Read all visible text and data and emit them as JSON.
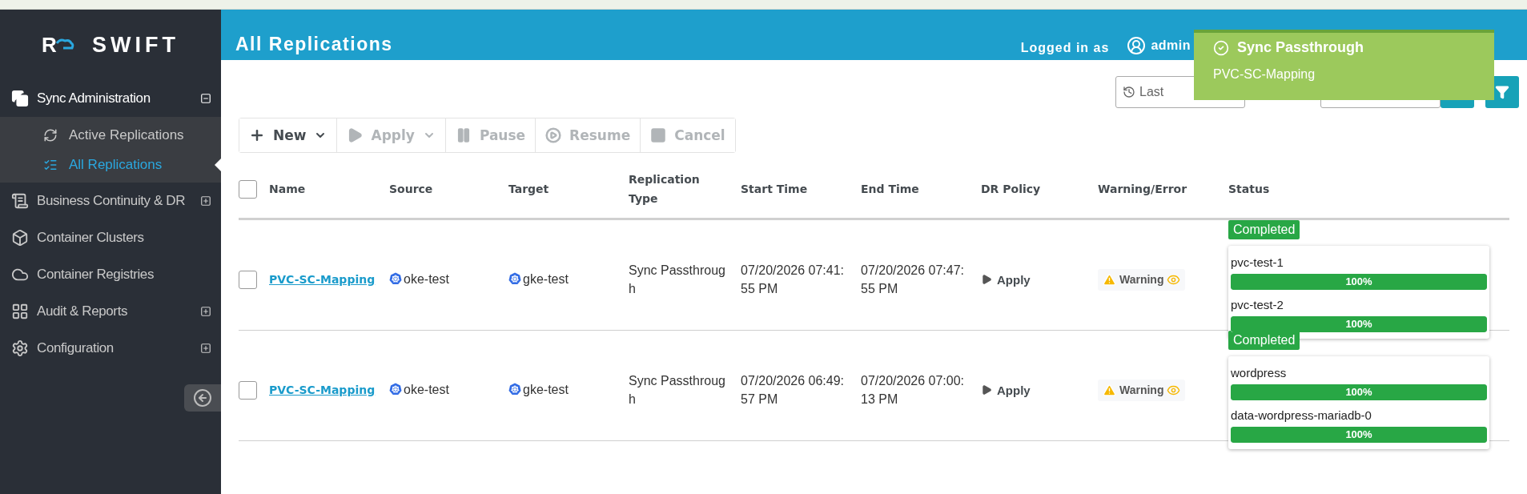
{
  "sidebar": {
    "logo": {
      "mark": "R",
      "text": "SWIFT"
    },
    "items": [
      {
        "label": "Sync Administration",
        "expanded": true,
        "children": [
          {
            "label": "Active Replications",
            "selected": false
          },
          {
            "label": "All Replications",
            "selected": true
          }
        ]
      },
      {
        "label": "Business Continuity & DR",
        "expanded": false
      },
      {
        "label": "Container Clusters"
      },
      {
        "label": "Container Registries"
      },
      {
        "label": "Audit & Reports",
        "expanded": false
      },
      {
        "label": "Configuration",
        "expanded": false
      }
    ]
  },
  "header": {
    "title": "All Replications",
    "logged_in_label": "Logged in as",
    "user": "admin"
  },
  "toast": {
    "title": "Sync Passthrough",
    "message": "PVC-SC-Mapping"
  },
  "filters": {
    "time_range": "Last"
  },
  "toolbar": [
    {
      "label": "New",
      "disabled": false,
      "dropdown": true
    },
    {
      "label": "Apply",
      "disabled": true,
      "dropdown": true
    },
    {
      "label": "Pause",
      "disabled": true,
      "dropdown": false
    },
    {
      "label": "Resume",
      "disabled": true,
      "dropdown": false
    },
    {
      "label": "Cancel",
      "disabled": true,
      "dropdown": false
    }
  ],
  "table": {
    "select_all_checked": false,
    "columns": [
      "Name",
      "Source",
      "Target",
      "Replication Type",
      "Start Time",
      "End Time",
      "DR Policy",
      "Warning/Error",
      "Status"
    ],
    "rows": [
      {
        "checked": false,
        "name": "PVC-SC-Mapping",
        "source": "oke-test",
        "target": "gke-test",
        "type": "Sync Passthrough",
        "start": "07/20/2026 07:41:55 PM",
        "end": "07/20/2026 07:47:55 PM",
        "dr_policy": "Apply",
        "warning": "Warning",
        "status": "Completed",
        "volumes": [
          {
            "name": "pvc-test-1",
            "level": 1,
            "reading": "100%"
          },
          {
            "name": "pvc-test-2",
            "level": 1,
            "reading": "100%"
          }
        ]
      },
      {
        "checked": false,
        "name": "PVC-SC-Mapping",
        "source": "oke-test",
        "target": "gke-test",
        "type": "Sync Passthrough",
        "start": "07/20/2026 06:49:57 PM",
        "end": "07/20/2026 07:00:13 PM",
        "dr_policy": "Apply",
        "warning": "Warning",
        "status": "Completed",
        "volumes": [
          {
            "name": "wordpress",
            "level": 1,
            "reading": "100%"
          },
          {
            "name": "data-wordpress-mariadb-0",
            "level": 1,
            "reading": "100%"
          }
        ]
      }
    ]
  }
}
